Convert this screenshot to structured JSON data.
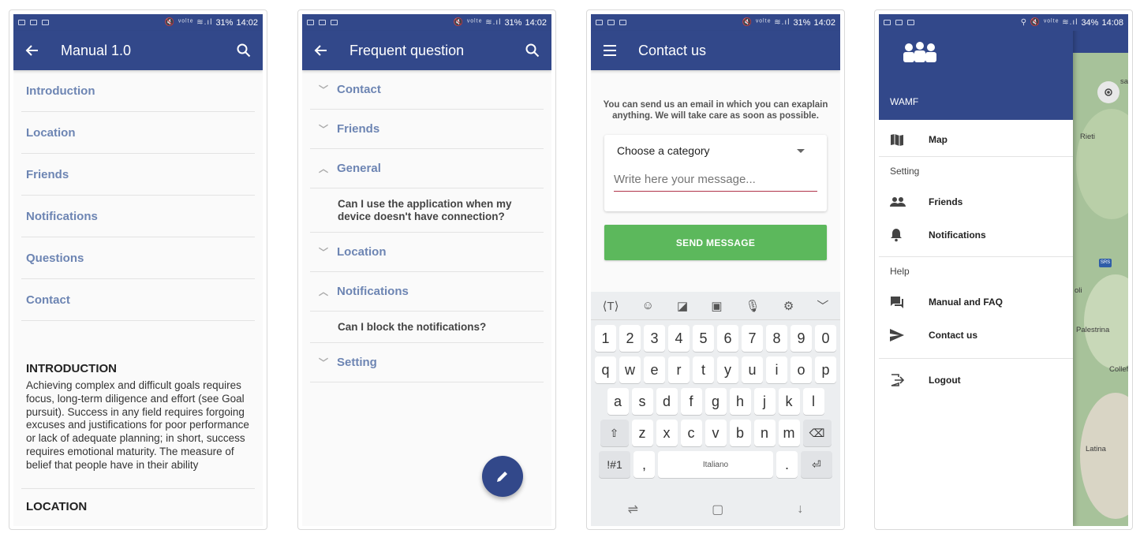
{
  "status_bars": [
    {
      "icons": "🔇 ᵛᵒˡᵗᵉ ≋.ıl",
      "battery": "31%",
      "time": "14:02"
    },
    {
      "icons": "🔇 ᵛᵒˡᵗᵉ ≋.ıl",
      "battery": "31%",
      "time": "14:02"
    },
    {
      "icons": "🔇 ᵛᵒˡᵗᵉ ≋.ıl",
      "battery": "31%",
      "time": "14:02"
    },
    {
      "icons": "⚲ 🔇 ᵛᵒˡᵗᵉ ≋.ıl",
      "battery": "34%",
      "time": "14:08"
    }
  ],
  "manual": {
    "title": "Manual 1.0",
    "toc": [
      "Introduction",
      "Location",
      "Friends",
      "Notifications",
      "Questions",
      "Contact"
    ],
    "intro_heading": "INTRODUCTION",
    "intro_text": "Achieving complex and difficult goals requires focus, long-term diligence and effort (see Goal pursuit). Success in any field requires forgoing excuses and justifications for poor performance or lack of adequate planning; in short, success requires emotional maturity. The measure of belief that people have in their ability",
    "next_heading": "LOCATION"
  },
  "faq": {
    "title": "Frequent question",
    "rows": [
      {
        "label": "Contact",
        "expanded": false
      },
      {
        "label": "Friends",
        "expanded": false
      },
      {
        "label": "General",
        "expanded": true,
        "question": "Can I use the application when my device doesn't have connection?"
      },
      {
        "label": "Location",
        "expanded": false
      },
      {
        "label": "Notifications",
        "expanded": true,
        "question": "Can I block the notifications?"
      },
      {
        "label": "Setting",
        "expanded": false
      }
    ]
  },
  "contact": {
    "title": "Contact us",
    "intro": "You can send us an email in which you can exaplain anything. We will take care as soon as possible.",
    "category_label": "Choose a category",
    "message_placeholder": "Write here your message...",
    "send_label": "SEND MESSAGE",
    "keyboard": {
      "row1": [
        "1",
        "2",
        "3",
        "4",
        "5",
        "6",
        "7",
        "8",
        "9",
        "0"
      ],
      "row2": [
        "q",
        "w",
        "e",
        "r",
        "t",
        "y",
        "u",
        "i",
        "o",
        "p"
      ],
      "row3": [
        "a",
        "s",
        "d",
        "f",
        "g",
        "h",
        "j",
        "k",
        "l"
      ],
      "row4": [
        "z",
        "x",
        "c",
        "v",
        "b",
        "n",
        "m"
      ],
      "symbols": "!#1",
      "comma": ",",
      "space": "Italiano",
      "period": "."
    }
  },
  "drawer": {
    "brand": "WAMF",
    "items": [
      {
        "label": "Map",
        "icon": "map-icon"
      }
    ],
    "setting_section": "Setting",
    "setting_items": [
      {
        "label": "Friends",
        "icon": "people-icon"
      },
      {
        "label": "Notifications",
        "icon": "bell-icon"
      }
    ],
    "help_section": "Help",
    "help_items": [
      {
        "label": "Manual and FAQ",
        "icon": "forum-icon"
      },
      {
        "label": "Contact us",
        "icon": "send-icon"
      }
    ],
    "logout": "Logout",
    "map_labels": [
      "Rieti",
      "Palestrina",
      "Latina",
      "Collefe",
      "oli",
      "sa"
    ],
    "map_shield": "SRS"
  },
  "colors": {
    "primary": "#32488a",
    "link": "#6d85b3",
    "send": "#5cb85c",
    "input_line": "#b0344a"
  }
}
